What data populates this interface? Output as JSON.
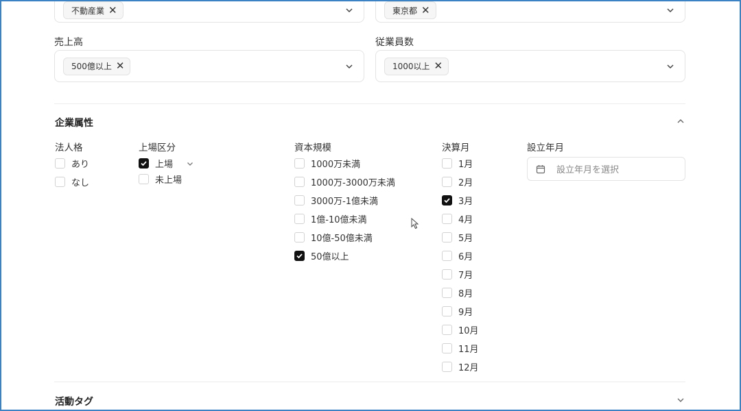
{
  "top_row": {
    "industry_chip": "不動産業",
    "region_chip": "東京都"
  },
  "sales": {
    "label": "売上高",
    "chip": "500億以上"
  },
  "employees": {
    "label": "従業員数",
    "chip": "1000以上"
  },
  "company_attributes": {
    "title": "企業属性",
    "corporate": {
      "label": "法人格",
      "options": [
        {
          "label": "あり",
          "checked": false
        },
        {
          "label": "なし",
          "checked": false
        }
      ]
    },
    "listing": {
      "label": "上場区分",
      "options": [
        {
          "label": "上場",
          "checked": true
        },
        {
          "label": "未上場",
          "checked": false
        }
      ]
    },
    "capital": {
      "label": "資本規模",
      "options": [
        {
          "label": "1000万未満",
          "checked": false
        },
        {
          "label": "1000万-3000万未満",
          "checked": false
        },
        {
          "label": "3000万-1億未満",
          "checked": false
        },
        {
          "label": "1億-10億未満",
          "checked": false
        },
        {
          "label": "10億-50億未満",
          "checked": false
        },
        {
          "label": "50億以上",
          "checked": true
        }
      ]
    },
    "fiscal_month": {
      "label": "決算月",
      "options": [
        {
          "label": "1月",
          "checked": false
        },
        {
          "label": "2月",
          "checked": false
        },
        {
          "label": "3月",
          "checked": true
        },
        {
          "label": "4月",
          "checked": false
        },
        {
          "label": "5月",
          "checked": false
        },
        {
          "label": "6月",
          "checked": false
        },
        {
          "label": "7月",
          "checked": false
        },
        {
          "label": "8月",
          "checked": false
        },
        {
          "label": "9月",
          "checked": false
        },
        {
          "label": "10月",
          "checked": false
        },
        {
          "label": "11月",
          "checked": false
        },
        {
          "label": "12月",
          "checked": false
        }
      ]
    },
    "founded": {
      "label": "設立年月",
      "placeholder": "設立年月を選択"
    }
  },
  "activity_tags": {
    "title": "活動タグ"
  },
  "icons": {
    "chevron": "chevron-down-icon",
    "remove": "close-icon",
    "calendar": "calendar-icon",
    "cursor": "mouse-pointer-icon"
  }
}
